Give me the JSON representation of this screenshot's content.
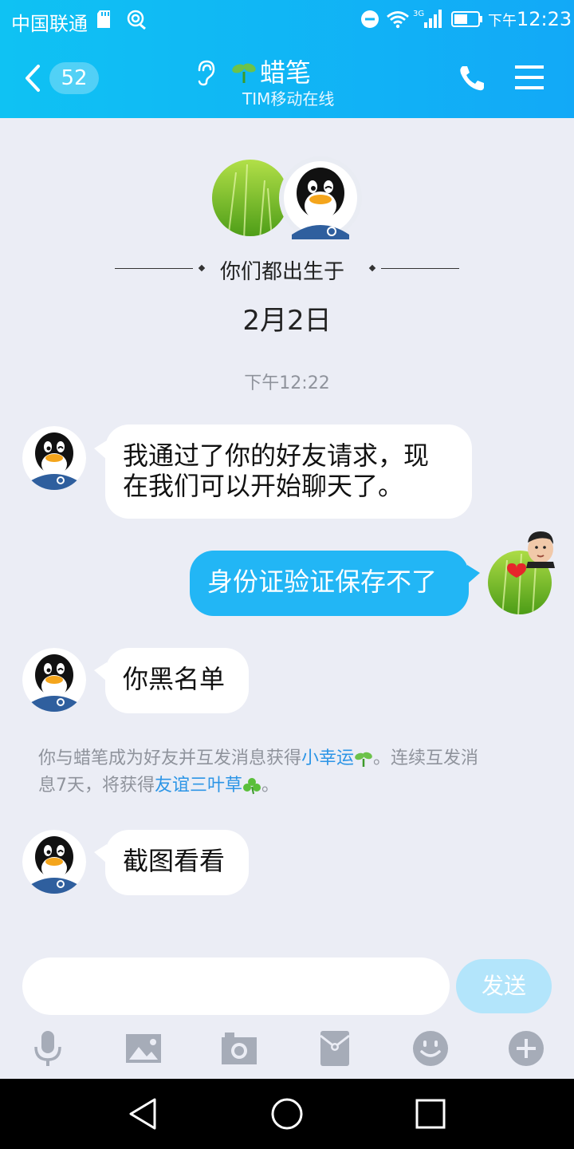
{
  "status_bar": {
    "carrier": "中国联通",
    "network": "3G",
    "time_prefix": "下午",
    "time": "12:23"
  },
  "header": {
    "unread_count": "52",
    "contact_name": "蜡笔",
    "online_status": "TIM移动在线"
  },
  "intro": {
    "birth_text": "你们都出生于",
    "birth_date": "2月2日"
  },
  "timestamp": "下午12:22",
  "messages": [
    {
      "direction": "in",
      "text_line1": "我通过了你的好友请求，现",
      "text_line2": "在我们可以开始聊天了。"
    },
    {
      "direction": "out",
      "text": "身份证验证保存不了"
    },
    {
      "direction": "in",
      "text": "你黑名单"
    },
    {
      "direction": "in",
      "text": "截图看看"
    }
  ],
  "system_note": {
    "part1": "你与蜡笔成为好友并互发消息获得",
    "link1": "小幸运",
    "part2": "。连续互发消",
    "part3": "息7天，将获得",
    "link2": "友谊三叶草",
    "part4": "。"
  },
  "input": {
    "value": "",
    "send_label": "发送"
  },
  "toolbar_icons": [
    "microphone-icon",
    "image-icon",
    "camera-icon",
    "red-packet-icon",
    "emoji-icon",
    "plus-icon"
  ],
  "colors": {
    "header_gradient_start": "#0fc2f3",
    "header_gradient_end": "#12a9f7",
    "outgoing_bubble": "#22b6f5",
    "incoming_bubble": "#ffffff",
    "chat_background": "#ebedf5",
    "link": "#2c95e6",
    "send_button": "#b3e5fb"
  }
}
